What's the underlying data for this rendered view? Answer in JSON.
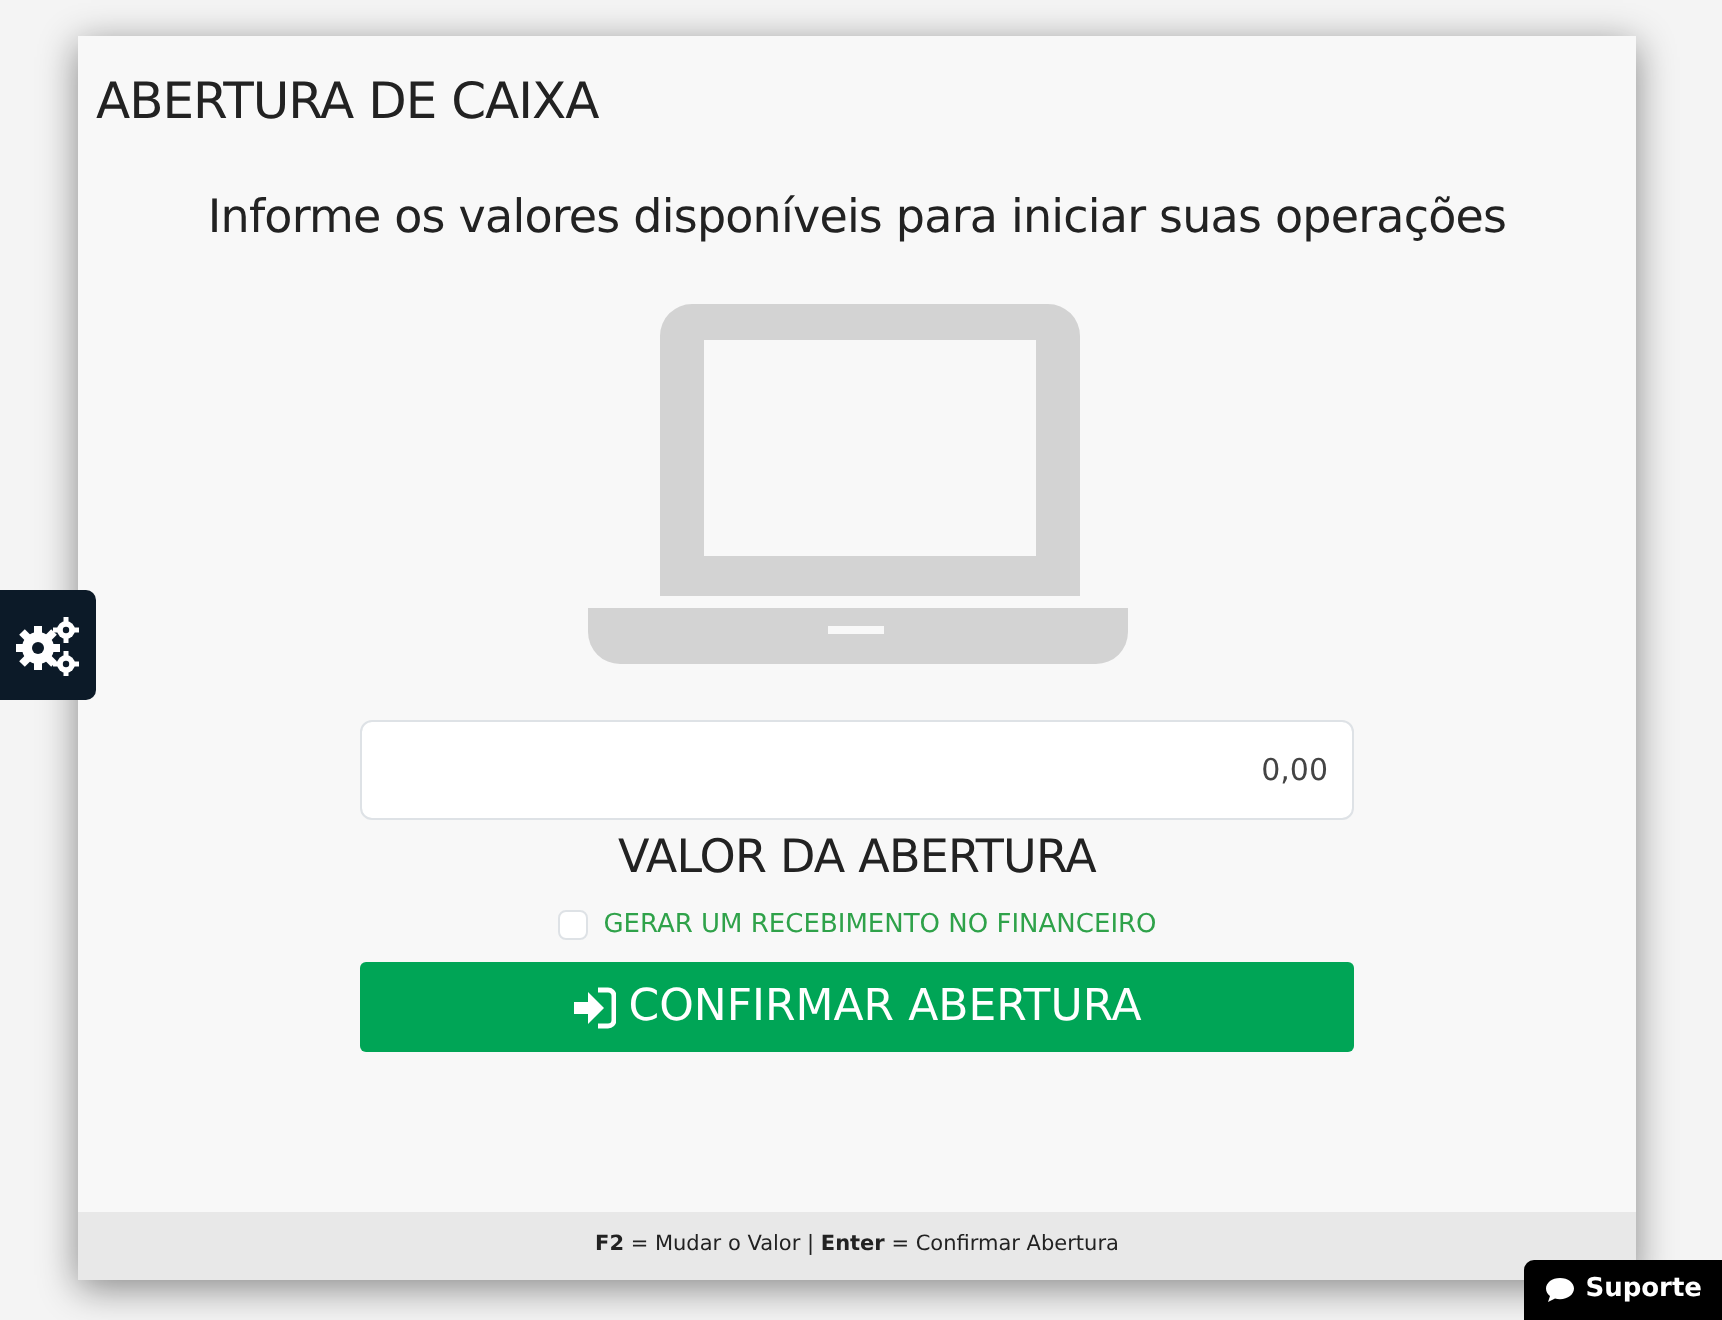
{
  "title": "ABERTURA DE CAIXA",
  "subtitle": "Informe os valores disponíveis para iniciar suas operações",
  "amount": {
    "value": "0,00",
    "label": "VALOR DA ABERTURA"
  },
  "receipt_option": {
    "label": "GERAR UM RECEBIMENTO NO FINANCEIRO",
    "checked": false
  },
  "confirm_button": "CONFIRMAR ABERTURA",
  "shortcuts": "**F2** = Mudar o Valor | **Enter** = Confirmar Abertura",
  "support_button": "Suporte"
}
